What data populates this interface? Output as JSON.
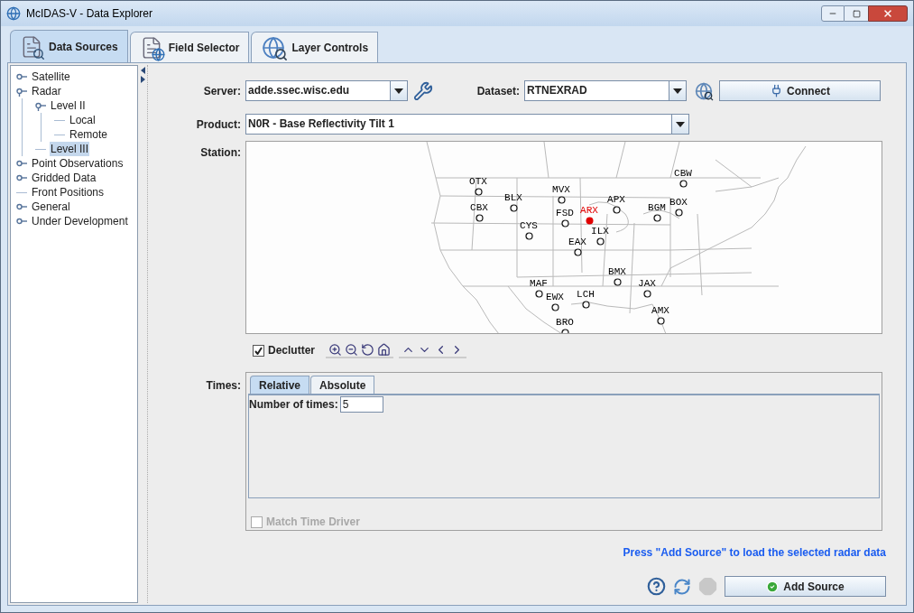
{
  "window": {
    "title": "McIDAS-V - Data Explorer"
  },
  "tabs": [
    {
      "label": "Data Sources",
      "selected": true,
      "kind": "sources"
    },
    {
      "label": "Field Selector",
      "selected": false,
      "kind": "fields"
    },
    {
      "label": "Layer Controls",
      "selected": false,
      "kind": "layers"
    }
  ],
  "tree": [
    {
      "label": "Satellite",
      "expanded": false,
      "selected": false
    },
    {
      "label": "Radar",
      "expanded": true,
      "selected": false,
      "children": [
        {
          "label": "Level II",
          "expanded": true,
          "selected": false,
          "children": [
            {
              "label": "Local",
              "selected": false
            },
            {
              "label": "Remote",
              "selected": false
            }
          ]
        },
        {
          "label": "Level III",
          "selected": true
        }
      ]
    },
    {
      "label": "Point Observations",
      "expanded": false,
      "selected": false
    },
    {
      "label": "Gridded Data",
      "expanded": false,
      "selected": false
    },
    {
      "label": "Front Positions",
      "selected": false
    },
    {
      "label": "General",
      "expanded": false,
      "selected": false
    },
    {
      "label": "Under Development",
      "expanded": false,
      "selected": false
    }
  ],
  "server": {
    "label": "Server:",
    "value": "adde.ssec.wisc.edu"
  },
  "dataset": {
    "label": "Dataset:",
    "value": "RTNEXRAD"
  },
  "connect_button": "Connect",
  "product": {
    "label": "Product:",
    "value": "N0R - Base Reflectivity Tilt 1"
  },
  "station": {
    "label": "Station:",
    "stations": [
      {
        "code": "CBW",
        "selected": false
      },
      {
        "code": "OTX",
        "selected": false
      },
      {
        "code": "MVX",
        "selected": false
      },
      {
        "code": "BLX",
        "selected": false
      },
      {
        "code": "APX",
        "selected": false
      },
      {
        "code": "BOX",
        "selected": false
      },
      {
        "code": "CBX",
        "selected": false
      },
      {
        "code": "ARX",
        "selected": true
      },
      {
        "code": "BGM",
        "selected": false
      },
      {
        "code": "FSD",
        "selected": false
      },
      {
        "code": "CYS",
        "selected": false
      },
      {
        "code": "ILX",
        "selected": false
      },
      {
        "code": "EAX",
        "selected": false
      },
      {
        "code": "BMX",
        "selected": false
      },
      {
        "code": "MAF",
        "selected": false
      },
      {
        "code": "JAX",
        "selected": false
      },
      {
        "code": "EWX",
        "selected": false
      },
      {
        "code": "LCH",
        "selected": false
      },
      {
        "code": "AMX",
        "selected": false
      },
      {
        "code": "BRO",
        "selected": false
      }
    ]
  },
  "declutter": {
    "label": "Declutter",
    "checked": true
  },
  "times": {
    "label": "Times:",
    "tabs": [
      {
        "label": "Relative",
        "selected": true
      },
      {
        "label": "Absolute",
        "selected": false
      }
    ],
    "count_label": "Number of times:",
    "count_value": "5"
  },
  "match_time_driver": {
    "label": "Match Time Driver",
    "checked": false,
    "disabled": true
  },
  "hint": "Press \"Add Source\" to load the selected radar data",
  "add_source_button": "Add Source"
}
